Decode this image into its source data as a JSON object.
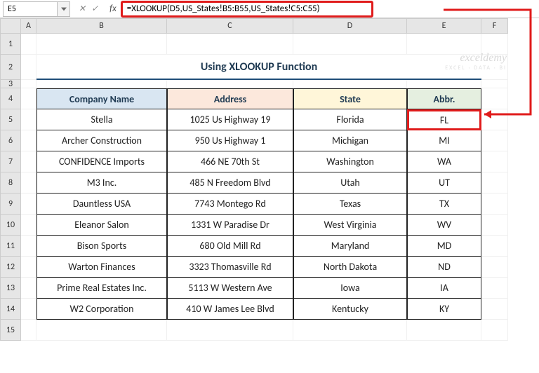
{
  "namebox": {
    "value": "E5"
  },
  "formula": "=XLOOKUP(D5,US_States!B5:B55,US_States!C5:C55)",
  "fx_label": "fx",
  "columns": [
    "A",
    "B",
    "C",
    "D",
    "E",
    "F"
  ],
  "rows": [
    "1",
    "2",
    "3",
    "4",
    "5",
    "6",
    "7",
    "8",
    "9",
    "10",
    "11",
    "12",
    "13",
    "14",
    "15"
  ],
  "title": "Using XLOOKUP Function",
  "headers": {
    "b": "Company Name",
    "c": "Address",
    "d": "State",
    "e": "Abbr."
  },
  "chart_data": {
    "type": "table",
    "columns": [
      "Company Name",
      "Address",
      "State",
      "Abbr."
    ],
    "rows": [
      {
        "company": "Stella",
        "address": "1025 Us Highway 19",
        "state": "Florida",
        "abbr": "FL"
      },
      {
        "company": "Archer Construction",
        "address": "950 Us Highway 1",
        "state": "Michigan",
        "abbr": "MI"
      },
      {
        "company": "CONFIDENCE Imports",
        "address": "466 NE 70th St",
        "state": "Washington",
        "abbr": "WA"
      },
      {
        "company": "M3 Inc.",
        "address": "485 N Freedom Blvd",
        "state": "Utah",
        "abbr": "UT"
      },
      {
        "company": "Dauntless USA",
        "address": "7743 Montego Rd",
        "state": "Texas",
        "abbr": "TX"
      },
      {
        "company": "Eleanor Salon",
        "address": "1331 W Paradise Dr",
        "state": "West Virginia",
        "abbr": "WV"
      },
      {
        "company": "Bison Sports",
        "address": "680 Old Mill Rd",
        "state": "Maryland",
        "abbr": "MD"
      },
      {
        "company": "Warton Finances",
        "address": "3323 Thomasville Rd",
        "state": "North Dakota",
        "abbr": "ND"
      },
      {
        "company": "Prime Real Estates Inc.",
        "address": "5113 W Western Ave",
        "state": "Iowa",
        "abbr": "IA"
      },
      {
        "company": "W2 Corporation",
        "address": "410 W James Lee Blvd",
        "state": "Kentucky",
        "abbr": "KY"
      }
    ]
  },
  "watermark": {
    "line1": "exceldemy",
    "line2": "EXCEL · DATA · BI"
  }
}
